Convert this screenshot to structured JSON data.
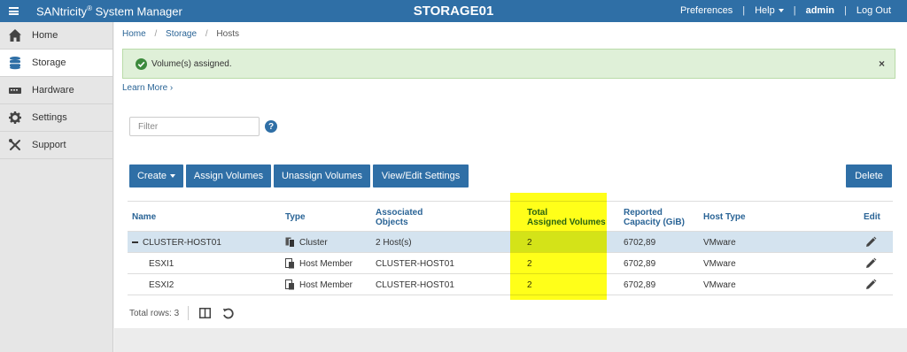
{
  "topbar": {
    "brand_name": "SANtricity",
    "brand_reg": "®",
    "brand_suffix": " System Manager",
    "system_name": "STORAGE01",
    "preferences": "Preferences",
    "help": "Help",
    "user": "admin",
    "logout": "Log Out",
    "separator": "|"
  },
  "sidebar": {
    "items": [
      {
        "label": "Home",
        "icon": "home-icon"
      },
      {
        "label": "Storage",
        "icon": "database-icon",
        "active": true
      },
      {
        "label": "Hardware",
        "icon": "hardware-icon"
      },
      {
        "label": "Settings",
        "icon": "gear-icon"
      },
      {
        "label": "Support",
        "icon": "tools-icon"
      }
    ]
  },
  "breadcrumb": {
    "home": "Home",
    "storage": "Storage",
    "current": "Hosts",
    "separator": "/"
  },
  "alert": {
    "message": "Volume(s) assigned.",
    "close": "×",
    "color": "#dff0d8"
  },
  "learn_more": "Learn More ›",
  "filter": {
    "placeholder": "Filter",
    "value": ""
  },
  "help_icon": "?",
  "toolbar": {
    "create": "Create",
    "assign": "Assign Volumes",
    "unassign": "Unassign Volumes",
    "view_edit": "View/Edit Settings",
    "delete": "Delete"
  },
  "table": {
    "headers": {
      "name": "Name",
      "type": "Type",
      "assoc_1": "Associated",
      "assoc_2": "Objects",
      "total_1": "Total",
      "total_2": "Assigned Volumes",
      "cap_1": "Reported",
      "cap_2": "Capacity (GiB)",
      "host_type": "Host Type",
      "edit": "Edit"
    },
    "rows": [
      {
        "name": "CLUSTER-HOST01",
        "type": "Cluster",
        "assoc": "2 Host(s)",
        "total": "2",
        "capacity": "6702,89",
        "host_type": "VMware"
      },
      {
        "name": "ESXI1",
        "type": "Host Member",
        "assoc": "CLUSTER-HOST01",
        "total": "2",
        "capacity": "6702,89",
        "host_type": "VMware"
      },
      {
        "name": "ESXI2",
        "type": "Host Member",
        "assoc": "CLUSTER-HOST01",
        "total": "2",
        "capacity": "6702,89",
        "host_type": "VMware"
      }
    ]
  },
  "footer": {
    "total_rows": "Total rows: 3"
  },
  "colors": {
    "accent": "#2f6fa6",
    "highlight": "#ffff00",
    "selected_row": "#d4e3ef"
  }
}
